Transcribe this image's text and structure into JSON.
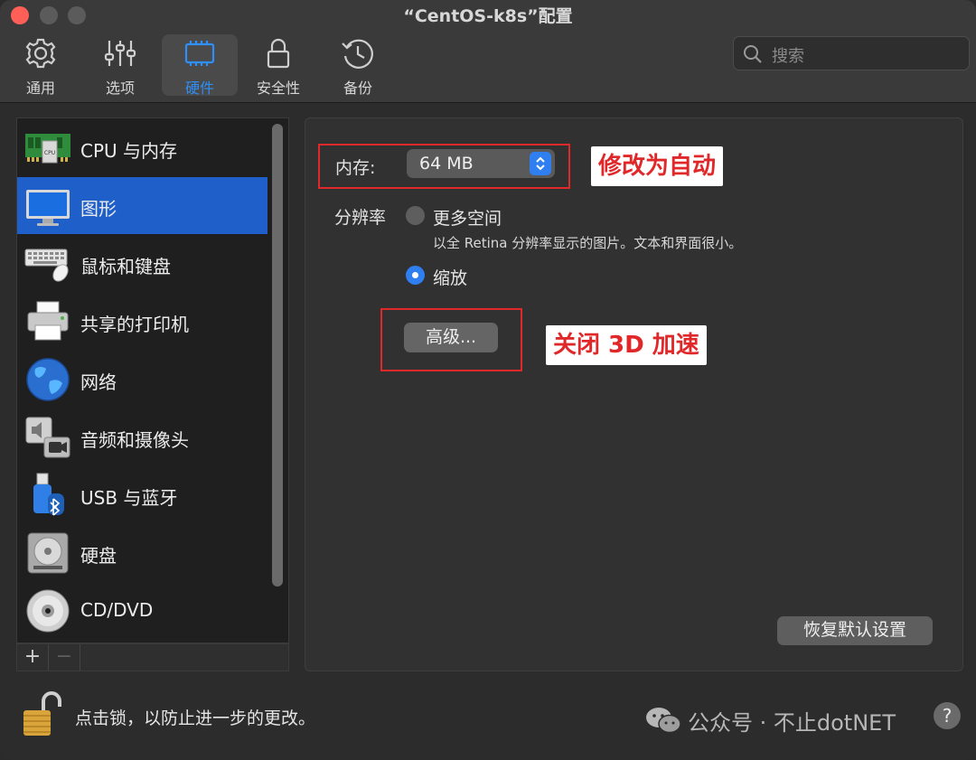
{
  "window": {
    "title": "“CentOS-k8s”配置"
  },
  "toolbar": {
    "tabs": [
      {
        "label": "通用",
        "icon": "gear-icon"
      },
      {
        "label": "选项",
        "icon": "sliders-icon"
      },
      {
        "label": "硬件",
        "icon": "chip-icon",
        "active": true
      },
      {
        "label": "安全性",
        "icon": "lock-icon"
      },
      {
        "label": "备份",
        "icon": "clock-backup-icon"
      }
    ],
    "search_placeholder": "搜索"
  },
  "sidebar": {
    "items": [
      {
        "label": "CPU 与内存",
        "icon": "memory-chip-icon"
      },
      {
        "label": "图形",
        "icon": "monitor-icon",
        "selected": true
      },
      {
        "label": "鼠标和键盘",
        "icon": "keyboard-mouse-icon"
      },
      {
        "label": "共享的打印机",
        "icon": "printer-icon"
      },
      {
        "label": "网络",
        "icon": "globe-icon"
      },
      {
        "label": "音频和摄像头",
        "icon": "speaker-camera-icon"
      },
      {
        "label": "USB 与蓝牙",
        "icon": "usb-bluetooth-icon"
      },
      {
        "label": "硬盘",
        "icon": "hard-disk-icon"
      },
      {
        "label": "CD/DVD",
        "icon": "cd-dvd-icon"
      }
    ],
    "add_label": "+",
    "remove_label": "−"
  },
  "graphics": {
    "memory_label": "内存:",
    "memory_value": "64 MB",
    "resolution_label": "分辨率",
    "option_more_space": "更多空间",
    "option_more_space_desc": "以全 Retina 分辨率显示的图片。文本和界面很小。",
    "option_scaled": "缩放",
    "selected_option": "缩放",
    "advanced_button": "高级...",
    "restore_button": "恢复默认设置"
  },
  "annotations": {
    "memory_note": "修改为自动",
    "advanced_note": "关闭 3D 加速"
  },
  "footer": {
    "lock_text": "点击锁，以防止进一步的更改。",
    "watermark": "公众号 · 不止dotNET",
    "help_label": "?"
  },
  "colors": {
    "accent": "#2f7ff0",
    "selection": "#1f5fc9",
    "annotation_red": "#e0282a"
  }
}
